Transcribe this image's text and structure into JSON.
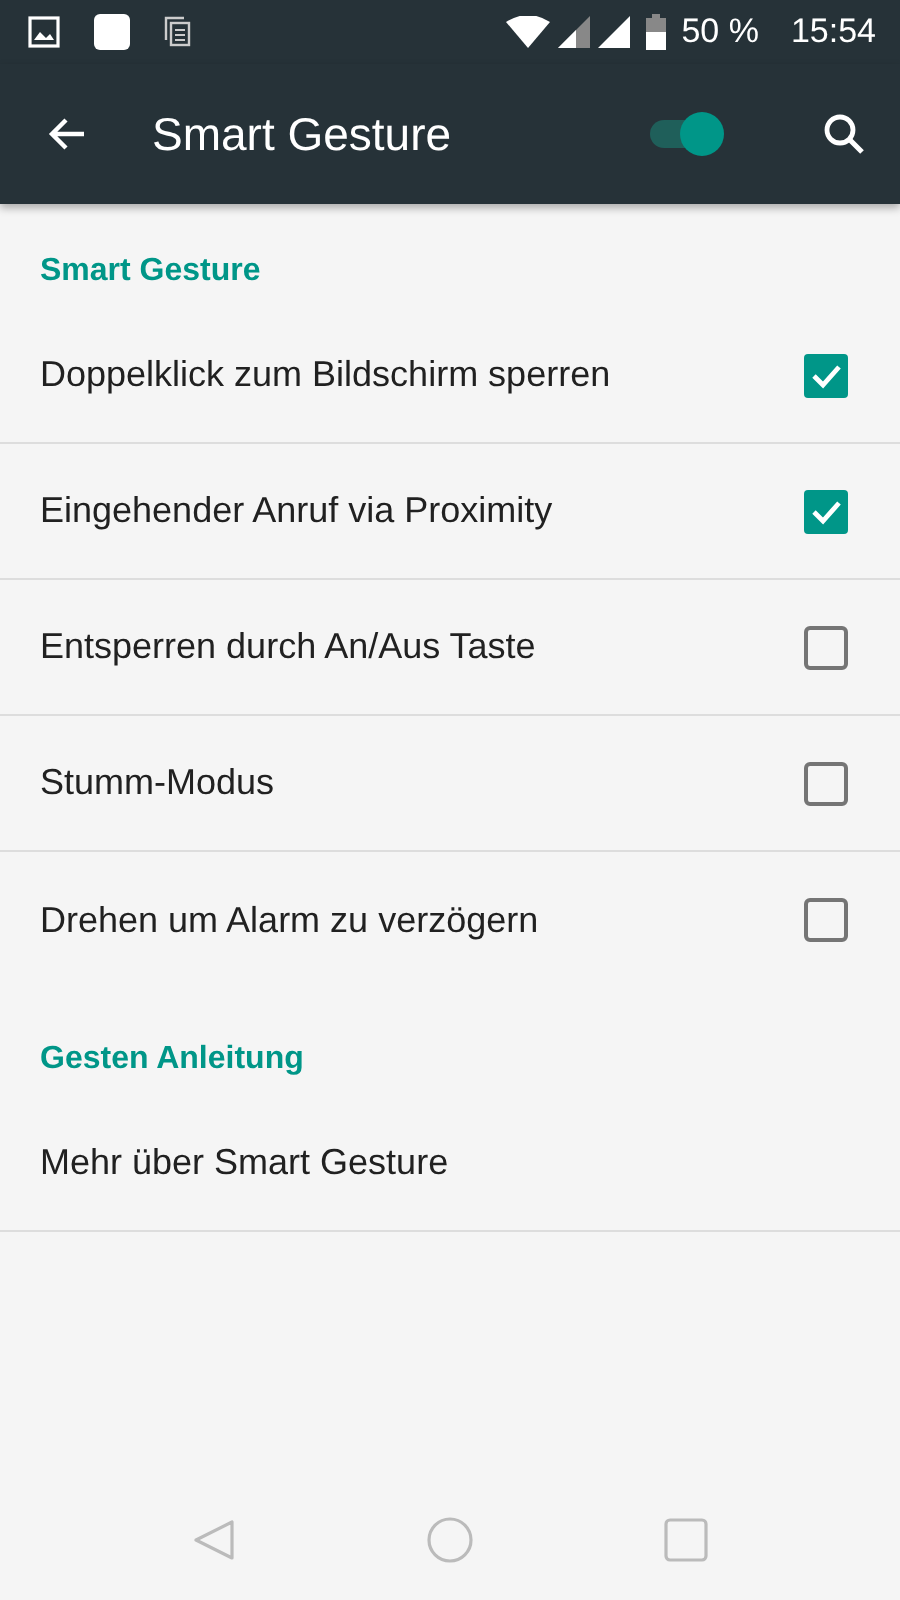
{
  "status_bar": {
    "battery": "50 %",
    "time": "15:54"
  },
  "toolbar": {
    "title": "Smart Gesture",
    "switch_on": true
  },
  "sections": [
    {
      "title": "Smart Gesture",
      "items": [
        {
          "label": "Doppelklick zum Bildschirm sperren",
          "kind": "checkbox",
          "checked": true
        },
        {
          "label": "Eingehender Anruf via Proximity",
          "kind": "checkbox",
          "checked": true
        },
        {
          "label": "Entsperren durch An/Aus Taste",
          "kind": "checkbox",
          "checked": false
        },
        {
          "label": "Stumm-Modus",
          "kind": "checkbox",
          "checked": false
        },
        {
          "label": "Drehen um Alarm zu verzögern",
          "kind": "checkbox",
          "checked": false
        }
      ]
    },
    {
      "title": "Gesten Anleitung",
      "items": [
        {
          "label": "Mehr über Smart Gesture",
          "kind": "link"
        }
      ]
    }
  ]
}
